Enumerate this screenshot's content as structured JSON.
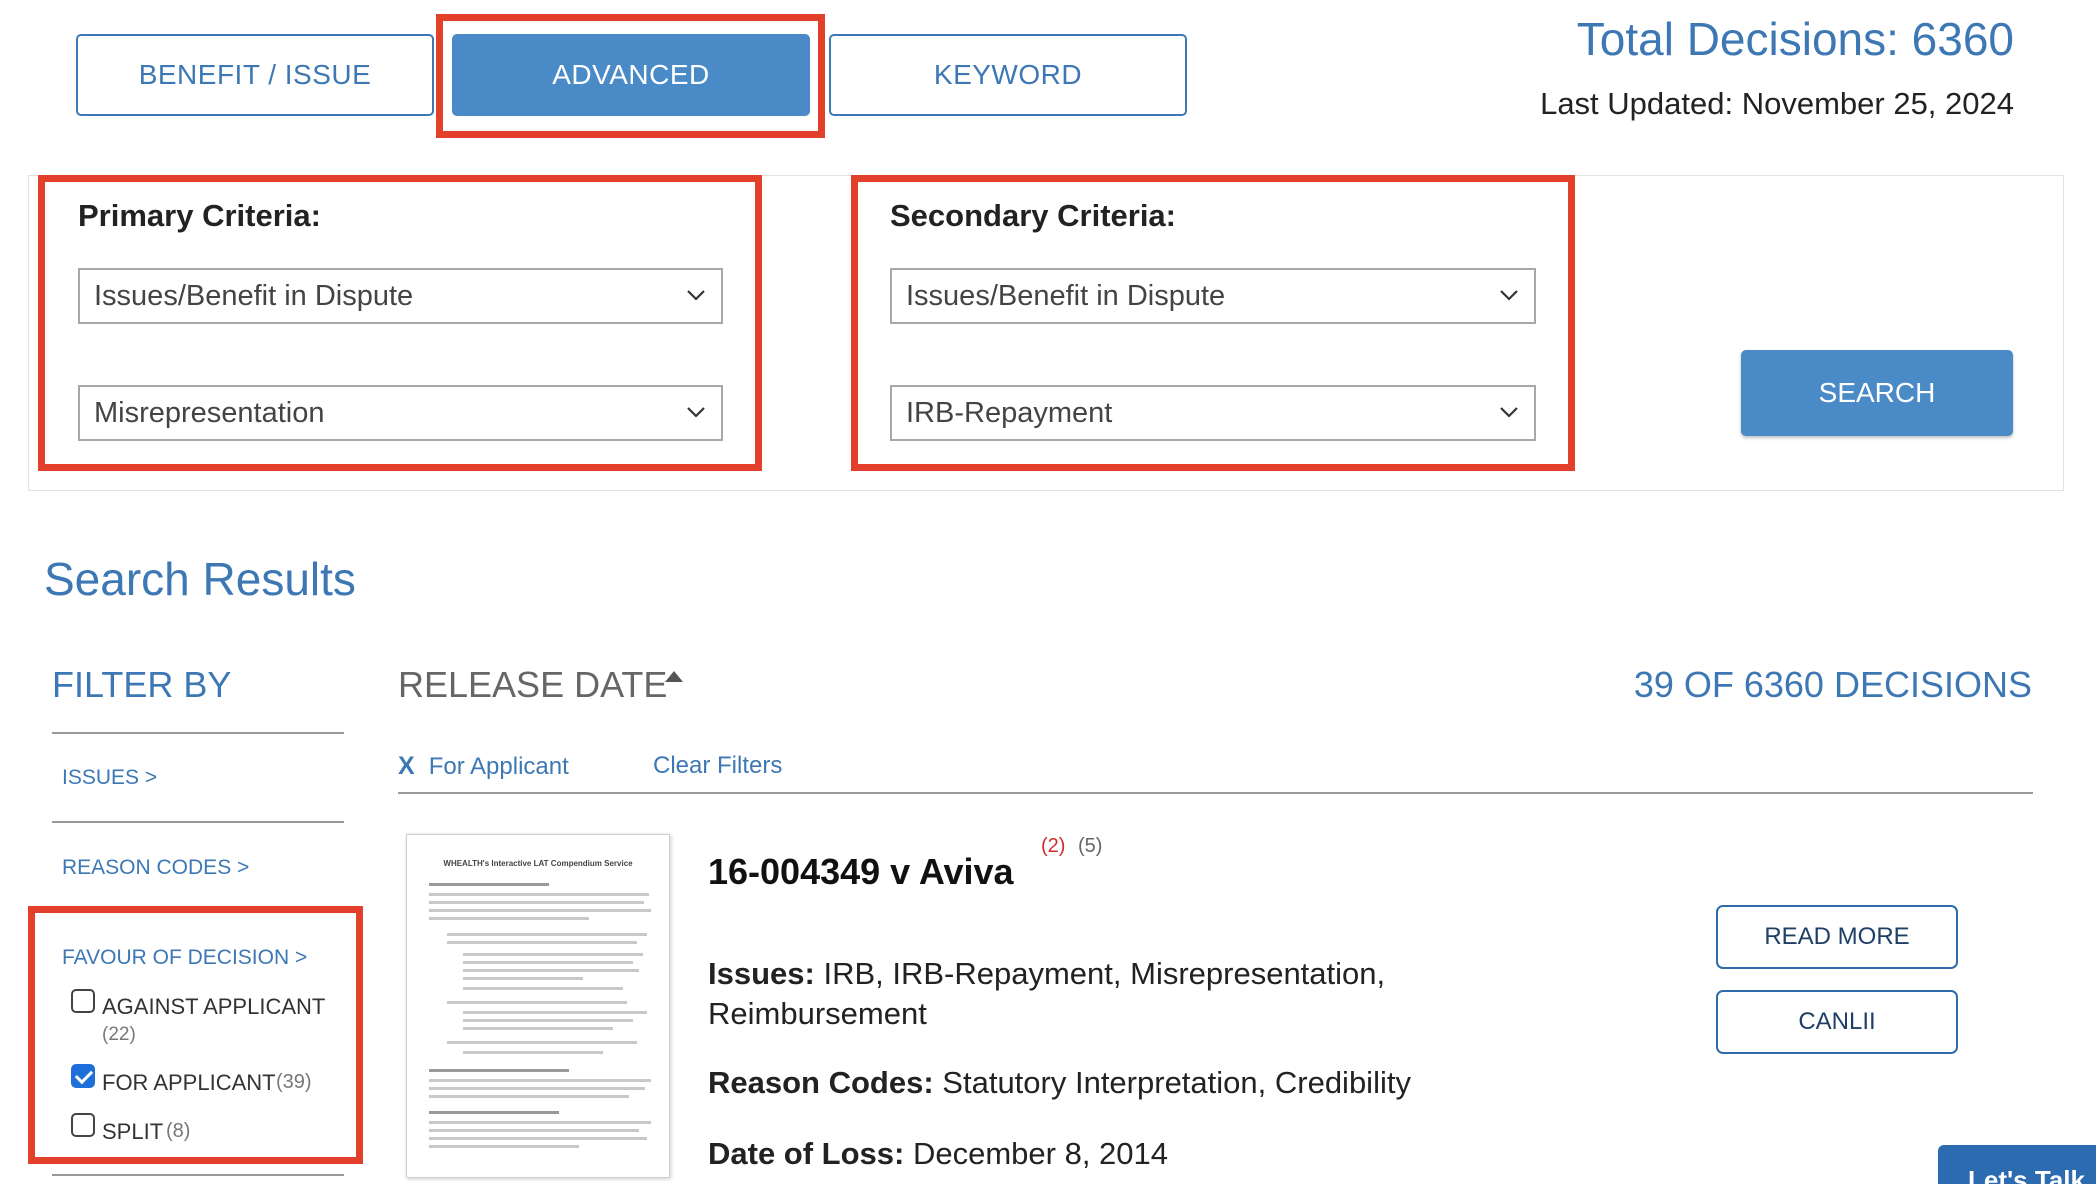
{
  "tabs": [
    {
      "label": "BENEFIT / ISSUE"
    },
    {
      "label": "ADVANCED"
    },
    {
      "label": "KEYWORD"
    }
  ],
  "summary": {
    "total_decisions": "Total Decisions: 6360",
    "last_updated": "Last Updated: November 25, 2024"
  },
  "primary": {
    "title": "Primary Criteria:",
    "field1": "Issues/Benefit in Dispute",
    "field2": "Misrepresentation"
  },
  "secondary": {
    "title": "Secondary Criteria:",
    "field1": "Issues/Benefit in Dispute",
    "field2": "IRB-Repayment"
  },
  "search_button": "SEARCH",
  "results": {
    "heading": "Search Results",
    "sort_label": "RELEASE DATE",
    "count": "39 OF 6360 DECISIONS",
    "active_filter_x": "X",
    "active_filter": "For Applicant",
    "clear_filters": "Clear Filters"
  },
  "filter": {
    "title": "FILTER BY",
    "issues": "ISSUES >",
    "reason_codes": "REASON CODES >",
    "favour": "FAVOUR OF DECISION >",
    "options": [
      {
        "label": "AGAINST APPLICANT",
        "count": "(22)",
        "checked": false
      },
      {
        "label": "FOR APPLICANT",
        "count": "(39)",
        "checked": true
      },
      {
        "label": "SPLIT",
        "count": "(8)",
        "checked": false
      }
    ]
  },
  "decision": {
    "title": "16-004349 v Aviva",
    "badge_red": "(2)",
    "badge_gray": "(5)",
    "issues_label": "Issues:",
    "issues_value": "IRB, IRB-Repayment, Misrepresentation, Reimbursement",
    "reason_label": "Reason Codes:",
    "reason_value": "Statutory Interpretation, Credibility",
    "loss_label": "Date of Loss:",
    "loss_value": "December 8, 2014",
    "read_more": "READ MORE",
    "canlii": "CANLII",
    "thumb_title": "WHEALTH's Interactive LAT Compendium Service"
  },
  "chat_button": "Let's Talk"
}
